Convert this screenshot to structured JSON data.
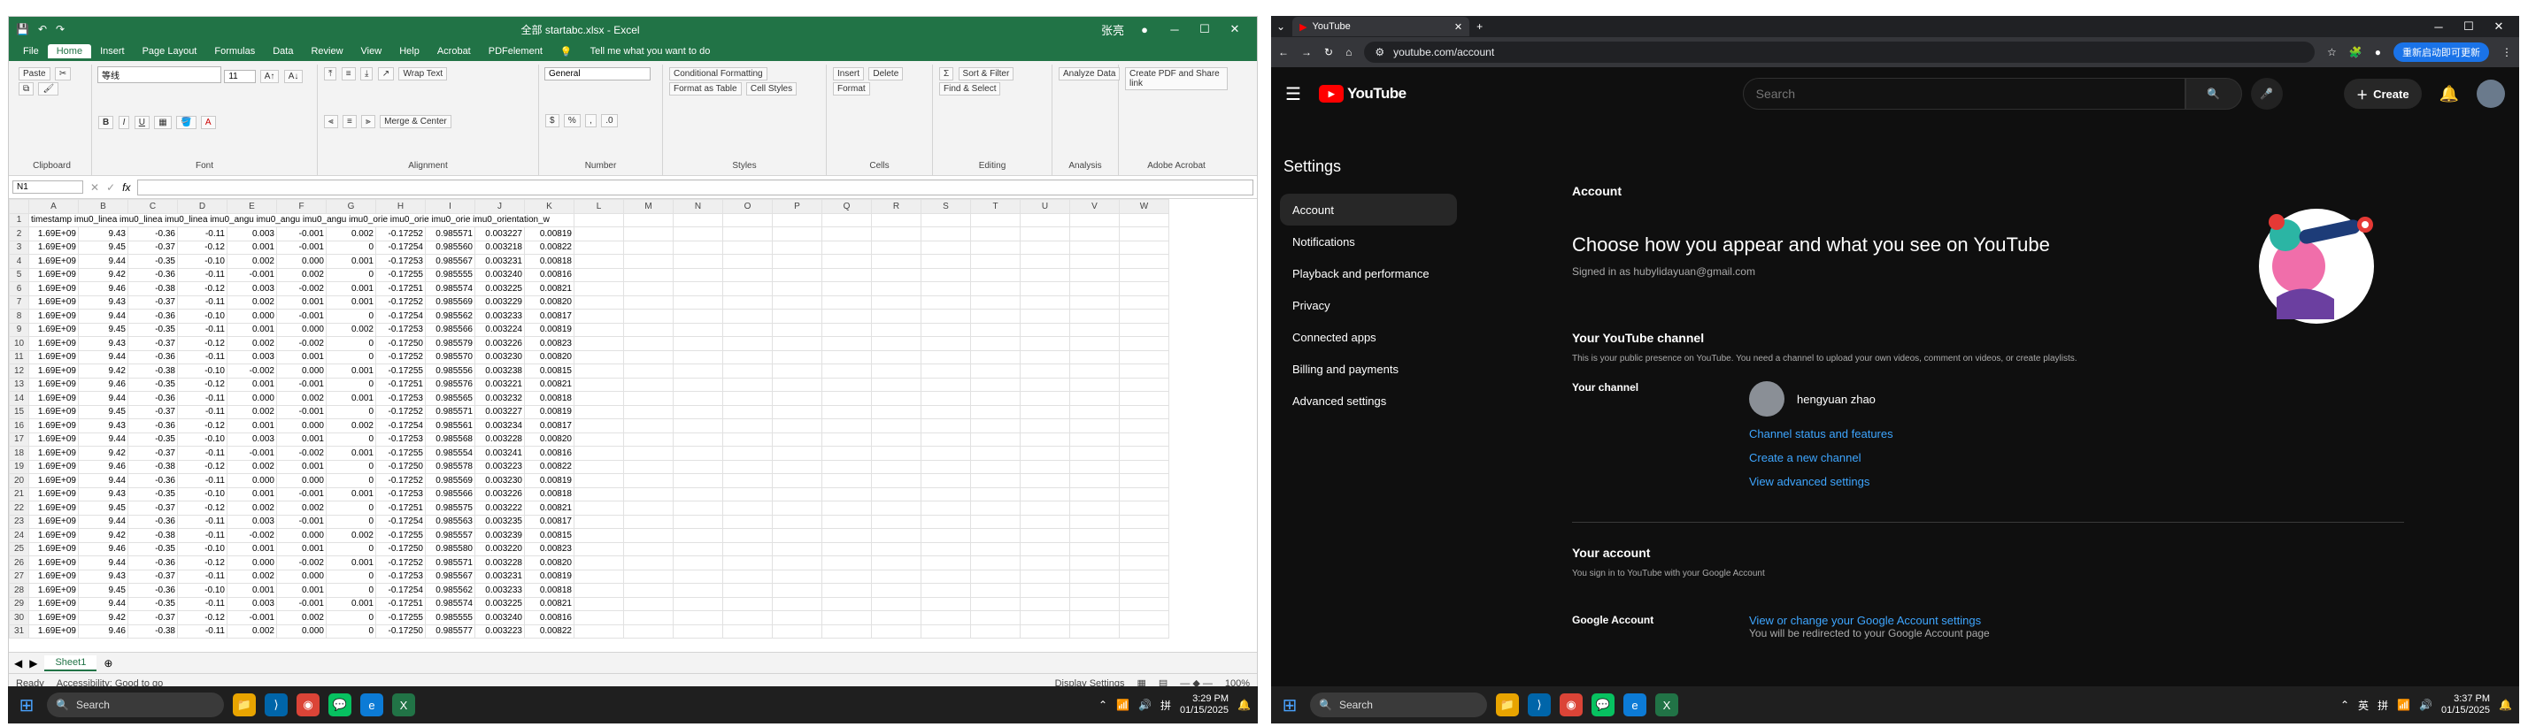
{
  "excel": {
    "title": "全部 startabc.xlsx - Excel",
    "window_icons": [
      "save-icon",
      "undo-icon",
      "redo-icon"
    ],
    "user": "张亮",
    "menus": [
      "File",
      "Home",
      "Insert",
      "Page Layout",
      "Formulas",
      "Data",
      "Review",
      "View",
      "Help",
      "Acrobat",
      "PDFelement"
    ],
    "active_menu": "Home",
    "tell_me": "Tell me what you want to do",
    "ribbon": {
      "paste": "Paste",
      "clipboard": "Clipboard",
      "font_name": "等线",
      "font_size": "11",
      "font_group": "Font",
      "wrap_text": "Wrap Text",
      "merge_center": "Merge & Center",
      "alignment": "Alignment",
      "number_format": "General",
      "number": "Number",
      "conditional_formatting": "Conditional Formatting",
      "format_as_table": "Format as Table",
      "cell_styles": "Cell Styles",
      "styles": "Styles",
      "insert": "Insert",
      "delete": "Delete",
      "format": "Format",
      "cells": "Cells",
      "sort_filter": "Sort & Filter",
      "find_select": "Find & Select",
      "editing": "Editing",
      "analyze_data": "Analyze Data",
      "analysis": "Analysis",
      "create_pdf": "Create PDF and Share link",
      "adobe": "Adobe Acrobat"
    },
    "name_box": "N1",
    "formula_icons": "fx",
    "columns": [
      "A",
      "B",
      "C",
      "D",
      "E",
      "F",
      "G",
      "H",
      "I",
      "J",
      "K",
      "L",
      "M",
      "N",
      "O",
      "P",
      "Q",
      "R",
      "S",
      "T",
      "U",
      "V",
      "W"
    ],
    "header_row": "timestamp imu0_linea imu0_linea imu0_linea imu0_angu imu0_angu imu0_angu imu0_orie imu0_orie imu0_orie imu0_orientation_w",
    "rows": [
      [
        "1.69E+09",
        "9.43",
        "-0.36",
        "-0.11",
        "0.003",
        "-0.001",
        "0.002",
        "-0.17252",
        "0.985571",
        "0.003227",
        "0.00819"
      ],
      [
        "1.69E+09",
        "9.45",
        "-0.37",
        "-0.12",
        "0.001",
        "-0.001",
        "0",
        "-0.17254",
        "0.985560",
        "0.003218",
        "0.00822"
      ],
      [
        "1.69E+09",
        "9.44",
        "-0.35",
        "-0.10",
        "0.002",
        "0.000",
        "0.001",
        "-0.17253",
        "0.985567",
        "0.003231",
        "0.00818"
      ],
      [
        "1.69E+09",
        "9.42",
        "-0.36",
        "-0.11",
        "-0.001",
        "0.002",
        "0",
        "-0.17255",
        "0.985555",
        "0.003240",
        "0.00816"
      ],
      [
        "1.69E+09",
        "9.46",
        "-0.38",
        "-0.12",
        "0.003",
        "-0.002",
        "0.001",
        "-0.17251",
        "0.985574",
        "0.003225",
        "0.00821"
      ],
      [
        "1.69E+09",
        "9.43",
        "-0.37",
        "-0.11",
        "0.002",
        "0.001",
        "0.001",
        "-0.17252",
        "0.985569",
        "0.003229",
        "0.00820"
      ],
      [
        "1.69E+09",
        "9.44",
        "-0.36",
        "-0.10",
        "0.000",
        "-0.001",
        "0",
        "-0.17254",
        "0.985562",
        "0.003233",
        "0.00817"
      ],
      [
        "1.69E+09",
        "9.45",
        "-0.35",
        "-0.11",
        "0.001",
        "0.000",
        "0.002",
        "-0.17253",
        "0.985566",
        "0.003224",
        "0.00819"
      ],
      [
        "1.69E+09",
        "9.43",
        "-0.37",
        "-0.12",
        "0.002",
        "-0.002",
        "0",
        "-0.17250",
        "0.985579",
        "0.003226",
        "0.00823"
      ],
      [
        "1.69E+09",
        "9.44",
        "-0.36",
        "-0.11",
        "0.003",
        "0.001",
        "0",
        "-0.17252",
        "0.985570",
        "0.003230",
        "0.00820"
      ],
      [
        "1.69E+09",
        "9.42",
        "-0.38",
        "-0.10",
        "-0.002",
        "0.000",
        "0.001",
        "-0.17255",
        "0.985556",
        "0.003238",
        "0.00815"
      ],
      [
        "1.69E+09",
        "9.46",
        "-0.35",
        "-0.12",
        "0.001",
        "-0.001",
        "0",
        "-0.17251",
        "0.985576",
        "0.003221",
        "0.00821"
      ],
      [
        "1.69E+09",
        "9.44",
        "-0.36",
        "-0.11",
        "0.000",
        "0.002",
        "0.001",
        "-0.17253",
        "0.985565",
        "0.003232",
        "0.00818"
      ],
      [
        "1.69E+09",
        "9.45",
        "-0.37",
        "-0.11",
        "0.002",
        "-0.001",
        "0",
        "-0.17252",
        "0.985571",
        "0.003227",
        "0.00819"
      ],
      [
        "1.69E+09",
        "9.43",
        "-0.36",
        "-0.12",
        "0.001",
        "0.000",
        "0.002",
        "-0.17254",
        "0.985561",
        "0.003234",
        "0.00817"
      ],
      [
        "1.69E+09",
        "9.44",
        "-0.35",
        "-0.10",
        "0.003",
        "0.001",
        "0",
        "-0.17253",
        "0.985568",
        "0.003228",
        "0.00820"
      ],
      [
        "1.69E+09",
        "9.42",
        "-0.37",
        "-0.11",
        "-0.001",
        "-0.002",
        "0.001",
        "-0.17255",
        "0.985554",
        "0.003241",
        "0.00816"
      ],
      [
        "1.69E+09",
        "9.46",
        "-0.38",
        "-0.12",
        "0.002",
        "0.001",
        "0",
        "-0.17250",
        "0.985578",
        "0.003223",
        "0.00822"
      ],
      [
        "1.69E+09",
        "9.44",
        "-0.36",
        "-0.11",
        "0.000",
        "0.000",
        "0",
        "-0.17252",
        "0.985569",
        "0.003230",
        "0.00819"
      ],
      [
        "1.69E+09",
        "9.43",
        "-0.35",
        "-0.10",
        "0.001",
        "-0.001",
        "0.001",
        "-0.17253",
        "0.985566",
        "0.003226",
        "0.00818"
      ],
      [
        "1.69E+09",
        "9.45",
        "-0.37",
        "-0.12",
        "0.002",
        "0.002",
        "0",
        "-0.17251",
        "0.985575",
        "0.003222",
        "0.00821"
      ],
      [
        "1.69E+09",
        "9.44",
        "-0.36",
        "-0.11",
        "0.003",
        "-0.001",
        "0",
        "-0.17254",
        "0.985563",
        "0.003235",
        "0.00817"
      ],
      [
        "1.69E+09",
        "9.42",
        "-0.38",
        "-0.11",
        "-0.002",
        "0.000",
        "0.002",
        "-0.17255",
        "0.985557",
        "0.003239",
        "0.00815"
      ],
      [
        "1.69E+09",
        "9.46",
        "-0.35",
        "-0.10",
        "0.001",
        "0.001",
        "0",
        "-0.17250",
        "0.985580",
        "0.003220",
        "0.00823"
      ],
      [
        "1.69E+09",
        "9.44",
        "-0.36",
        "-0.12",
        "0.000",
        "-0.002",
        "0.001",
        "-0.17252",
        "0.985571",
        "0.003228",
        "0.00820"
      ],
      [
        "1.69E+09",
        "9.43",
        "-0.37",
        "-0.11",
        "0.002",
        "0.000",
        "0",
        "-0.17253",
        "0.985567",
        "0.003231",
        "0.00819"
      ],
      [
        "1.69E+09",
        "9.45",
        "-0.36",
        "-0.10",
        "0.001",
        "0.001",
        "0",
        "-0.17254",
        "0.985562",
        "0.003233",
        "0.00818"
      ],
      [
        "1.69E+09",
        "9.44",
        "-0.35",
        "-0.11",
        "0.003",
        "-0.001",
        "0.001",
        "-0.17251",
        "0.985574",
        "0.003225",
        "0.00821"
      ],
      [
        "1.69E+09",
        "9.42",
        "-0.37",
        "-0.12",
        "-0.001",
        "0.002",
        "0",
        "-0.17255",
        "0.985555",
        "0.003240",
        "0.00816"
      ],
      [
        "1.69E+09",
        "9.46",
        "-0.38",
        "-0.11",
        "0.002",
        "0.000",
        "0",
        "-0.17250",
        "0.985577",
        "0.003223",
        "0.00822"
      ]
    ],
    "sheet_tab": "Sheet1",
    "status_left": "Ready",
    "accessibility": "Accessibility: Good to go",
    "display_settings": "Display Settings",
    "zoom": "100%"
  },
  "taskbar_left": {
    "search": "Search",
    "time": "3:29 PM",
    "date": "01/15/2025"
  },
  "taskbar_right": {
    "search": "Search",
    "time": "3:37 PM",
    "date": "01/15/2025",
    "ime": "英",
    "ime2": "拼"
  },
  "youtube": {
    "tab_title": "YouTube",
    "url": "youtube.com/account",
    "update_btn": "重新启动即可更新",
    "search_placeholder": "Search",
    "create": "Create",
    "sidebar_title": "Settings",
    "sidebar": [
      "Account",
      "Notifications",
      "Playback and performance",
      "Privacy",
      "Connected apps",
      "Billing and payments",
      "Advanced settings"
    ],
    "section_account": "Account",
    "headline": "Choose how you appear and what you see on YouTube",
    "signed_in": "Signed in as hubylidayuan@gmail.com",
    "channel_title": "Your YouTube channel",
    "channel_desc": "This is your public presence on YouTube. You need a channel to upload your own videos, comment on videos, or create playlists.",
    "your_channel": "Your channel",
    "channel_name": "hengyuan zhao",
    "links": [
      "Channel status and features",
      "Create a new channel",
      "View advanced settings"
    ],
    "account_title": "Your account",
    "account_desc": "You sign in to YouTube with your Google Account",
    "google_account": "Google Account",
    "google_link": "View or change your Google Account settings",
    "google_note": "You will be redirected to your Google Account page"
  }
}
